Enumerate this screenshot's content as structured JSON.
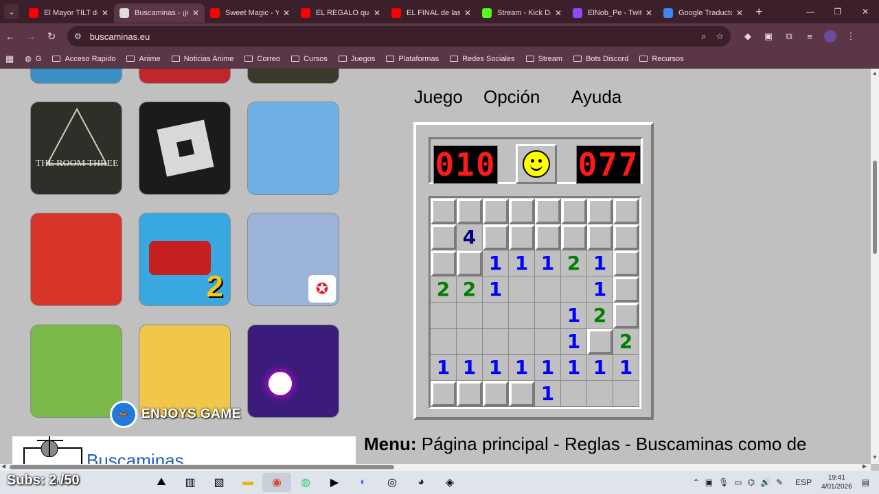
{
  "tabs": [
    {
      "title": "El Mayor TILT de",
      "favicon_color": "#ff0000",
      "active": false
    },
    {
      "title": "Buscaminas - ¡jue",
      "favicon_color": "#dddddd",
      "active": true
    },
    {
      "title": "Sweet Magic - Yo",
      "favicon_color": "#ff0000",
      "active": false
    },
    {
      "title": "EL REGALO que l",
      "favicon_color": "#ff0000",
      "active": false
    },
    {
      "title": "EL FINAL de las l",
      "favicon_color": "#ff0000",
      "active": false
    },
    {
      "title": "Stream - Kick Da",
      "favicon_color": "#53fc18",
      "active": false
    },
    {
      "title": "ElNob_Pe - Twitc",
      "favicon_color": "#9146ff",
      "active": false
    },
    {
      "title": "Google Traducto",
      "favicon_color": "#4285f4",
      "active": false
    }
  ],
  "address": {
    "url": "buscaminas.eu"
  },
  "bookmarks": [
    "G",
    "Acceso Rapido",
    "Anime",
    "Noticias Anime",
    "Correo",
    "Cursos",
    "Juegos",
    "Plataformas",
    "Redes Sociales",
    "Stream",
    "Bots Discord",
    "Recursos"
  ],
  "thumbnails": [
    {
      "name": "the-room-three",
      "label": "THE ROOM THREE",
      "bg": "#2f2f2a"
    },
    {
      "name": "roblox",
      "label": "",
      "bg": "#1b1b1b"
    },
    {
      "name": "human-fall-flat",
      "label": "",
      "bg": "#6fb1e6"
    },
    {
      "name": "talking-tom-gold-run",
      "label": "",
      "bg": "#d8352a"
    },
    {
      "name": "hill-climb-racing-2",
      "label": "2",
      "bg": "#39a7e0"
    },
    {
      "name": "free-fire",
      "label": "",
      "bg": "#9bb3d6"
    },
    {
      "name": "bloons-td-battles",
      "label": "",
      "bg": "#7ab84a"
    },
    {
      "name": "toca-kitchen",
      "label": "",
      "bg": "#f0c64b"
    },
    {
      "name": "tiles-hop",
      "label": "",
      "bg": "#3b1c7a"
    }
  ],
  "overlay": {
    "brand": "ENJOYS GAME"
  },
  "game_menu": {
    "juego": "Juego",
    "opcion": "Opción",
    "ayuda": "Ayuda"
  },
  "minesweeper": {
    "mines_counter": "010",
    "timer": "077",
    "face": "smile",
    "grid": [
      [
        "h",
        "h",
        "h",
        "h",
        "h",
        "h",
        "h",
        "h"
      ],
      [
        "h",
        "4",
        "h",
        "h",
        "h",
        "h",
        "h",
        "h"
      ],
      [
        "h",
        "h",
        "1",
        "1",
        "1",
        "2",
        "1",
        "h"
      ],
      [
        "2",
        "2",
        "1",
        "0",
        "0",
        "0",
        "1",
        "h"
      ],
      [
        "0",
        "0",
        "0",
        "0",
        "0",
        "1",
        "2",
        "h"
      ],
      [
        "0",
        "0",
        "0",
        "0",
        "0",
        "1",
        "h",
        "2"
      ],
      [
        "1",
        "1",
        "1",
        "1",
        "1",
        "1",
        "1",
        "1"
      ],
      [
        "h",
        "h",
        "h",
        "h",
        "1",
        "0",
        "0",
        "0"
      ]
    ]
  },
  "footer": {
    "logo_link": "Buscaminas",
    "menu_label": "Menu:",
    "menu_text": " Página principal - Reglas - Buscaminas como de"
  },
  "taskbar": {
    "subs": "Subs: 2 /50",
    "search": "Buscar",
    "lang": "ESP",
    "time": "19:41",
    "date": "4/01/2026"
  }
}
